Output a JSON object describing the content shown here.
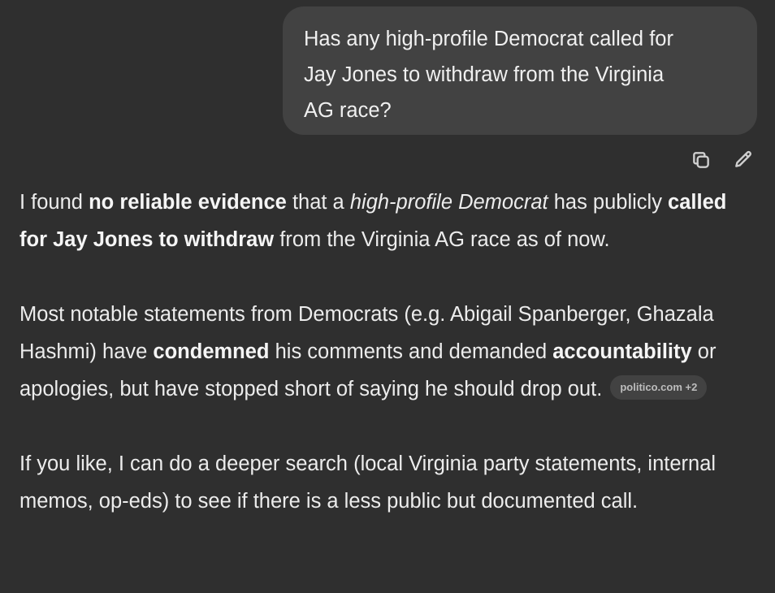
{
  "user_message": {
    "line1": "Has any high-profile Democrat called for",
    "line2": "Jay Jones to withdraw from the Virginia",
    "line3": "AG race?"
  },
  "message_actions": {
    "copy_icon": "copy-icon",
    "edit_icon": "pencil-icon"
  },
  "assistant": {
    "p1": {
      "t1": "I found ",
      "b1": "no reliable evidence",
      "t2": " that a ",
      "i1": "high-profile Democrat",
      "t3": " has publicly ",
      "b2": "called for Jay Jones to withdraw",
      "t4": " from the Virginia AG race as of now."
    },
    "p2": {
      "t1": "Most notable statements from Democrats (e.g. Abigail Spanberger, Ghazala Hashmi) have ",
      "b1": "condemned",
      "t2": " his comments and demanded ",
      "b2": "accountability",
      "t3": " or apologies, but have stopped short of saying he should drop out.",
      "source_pill": "politico.com +2"
    },
    "p3": {
      "t1": "If you like, I can do a deeper search (local Virginia party statements, internal memos, op-eds) to see if there is a less public but documented call."
    }
  }
}
